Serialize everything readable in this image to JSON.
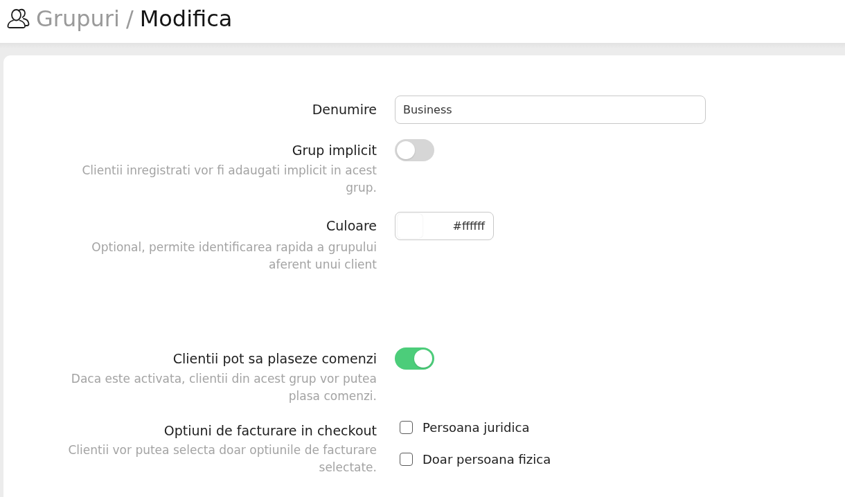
{
  "breadcrumb": {
    "parent": "Grupuri",
    "separator": "/",
    "current": "Modifica"
  },
  "form": {
    "sections": [
      {
        "fields": [
          {
            "kind": "text",
            "label": "Denumire",
            "value": "Business"
          },
          {
            "kind": "toggle",
            "label": "Grup implicit",
            "hint": "Clientii inregistrati vor fi adaugati implicit in acest grup.",
            "on": false
          },
          {
            "kind": "color",
            "label": "Culoare",
            "hint": "Optional, permite identificarea rapida a grupului aferent unui client",
            "value": "#ffffff"
          }
        ]
      },
      {
        "fields": [
          {
            "kind": "toggle",
            "label": "Clientii pot sa plaseze comenzi",
            "hint": "Daca este activata, clientii din acest grup vor putea plasa comenzi.",
            "on": true
          },
          {
            "kind": "checkboxes",
            "label": "Optiuni de facturare in checkout",
            "hint": "Clientii vor putea selecta doar optiunile de facturare selectate.",
            "options": [
              {
                "label": "Persoana juridica",
                "checked": false
              },
              {
                "label": "Doar persoana fizica",
                "checked": false
              }
            ]
          }
        ]
      }
    ]
  }
}
